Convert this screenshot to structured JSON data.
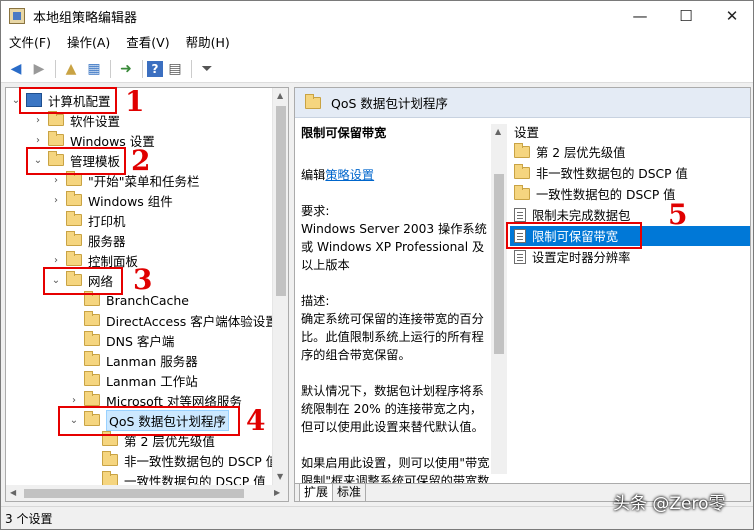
{
  "window": {
    "title": "本地组策略编辑器",
    "minimize_glyph": "—",
    "maximize_glyph": "☐",
    "close_glyph": "✕"
  },
  "menu": [
    "文件(F)",
    "操作(A)",
    "查看(V)",
    "帮助(H)"
  ],
  "toolbar": {
    "icons": [
      "back-icon",
      "forward-icon",
      "up-folder-icon",
      "show-hide-tree-icon",
      "export-list-icon",
      "help-icon",
      "properties-icon",
      "filter-icon"
    ],
    "glyphs": [
      "◀",
      "▶",
      "▲",
      "▦",
      "➜",
      "?",
      "▤",
      "⏷"
    ]
  },
  "tree": {
    "root": "计算机配置",
    "software": "软件设置",
    "windows_settings": "Windows 设置",
    "admin_templates": "管理模板",
    "start_menu": "\"开始\"菜单和任务栏",
    "windows_components": "Windows 组件",
    "printers": "打印机",
    "server": "服务器",
    "control_panel": "控制面板",
    "network": "网络",
    "network_children": [
      "BranchCache",
      "DirectAccess 客户端体验设置",
      "DNS 客户端",
      "Lanman 服务器",
      "Lanman 工作站",
      "Microsoft 对等网络服务"
    ],
    "qos": "QoS 数据包计划程序",
    "qos_children": [
      "第 2 层优先级值",
      "非一致性数据包的 DSCP 值",
      "一致性数据包的 DSCP 值"
    ]
  },
  "right": {
    "header": "QoS 数据包计划程序",
    "desc_title": "限制可保留带宽",
    "edit_prefix": "编辑",
    "edit_link": "策略设置",
    "requirements": "要求:\nWindows Server 2003 操作系统或 Windows XP Professional 及以上版本",
    "description": "描述:\n确定系统可保留的连接带宽的百分比。此值限制系统上运行的所有程序的组合带宽保留。",
    "default": "默认情况下，数据包计划程序将系统限制在 20% 的连接带宽之内，但可以使用此设置来替代默认值。",
    "if_enabled": "如果启用此设置，则可以使用\"带宽限制\"框来调整系统可保留的带宽数量。",
    "settings_header": "设置",
    "settings": [
      "第 2 层优先级值",
      "非一致性数据包的 DSCP 值",
      "一致性数据包的 DSCP 值",
      "限制未完成数据包",
      "限制可保留带宽",
      "设置定时器分辨率"
    ],
    "tabs": [
      "扩展",
      "标准"
    ]
  },
  "status": "3 个设置",
  "annotations": [
    "1",
    "2",
    "3",
    "4",
    "5"
  ],
  "watermark": "头条 @Zero零",
  "accent_color": "#0078d7",
  "annotation_color": "#e60000"
}
